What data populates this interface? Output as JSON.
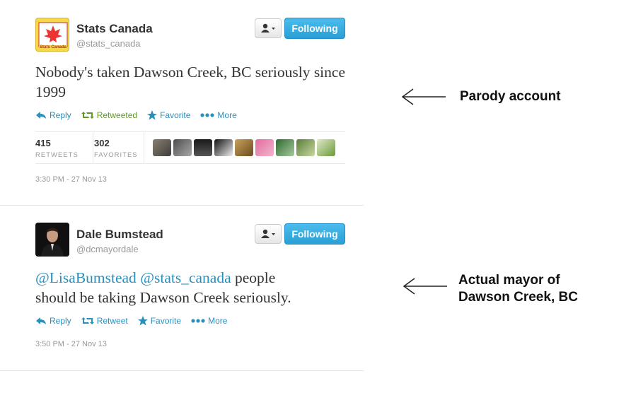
{
  "tweets": [
    {
      "name": "Stats Canada",
      "handle": "@stats_canada",
      "avatar_text": "Stats Canada",
      "follow_label": "Following",
      "text": "Nobody's taken Dawson Creek, BC seriously since 1999",
      "actions": {
        "reply": "Reply",
        "retweet": "Retweeted",
        "favorite": "Favorite",
        "more": "More"
      },
      "retweets_count": "415",
      "retweets_label": "RETWEETS",
      "favorites_count": "302",
      "favorites_label": "FAVORITES",
      "timestamp": "3:30 PM - 27 Nov 13"
    },
    {
      "name": "Dale Bumstead",
      "handle": "@dcmayordale",
      "follow_label": "Following",
      "text_mention1": "@LisaBumstead",
      "text_mention2": "@stats_canada",
      "text_rest1": " people",
      "text_rest2": "should be taking Dawson Creek seriously.",
      "actions": {
        "reply": "Reply",
        "retweet": "Retweet",
        "favorite": "Favorite",
        "more": "More"
      },
      "timestamp": "3:50 PM - 27 Nov 13"
    }
  ],
  "annotations": {
    "first": "Parody account",
    "second_line1": "Actual mayor of",
    "second_line2": "Dawson Creek, BC"
  },
  "colors": {
    "link": "#2a8fbd",
    "retweeted": "#609928",
    "follow": "#2a9fd6"
  }
}
